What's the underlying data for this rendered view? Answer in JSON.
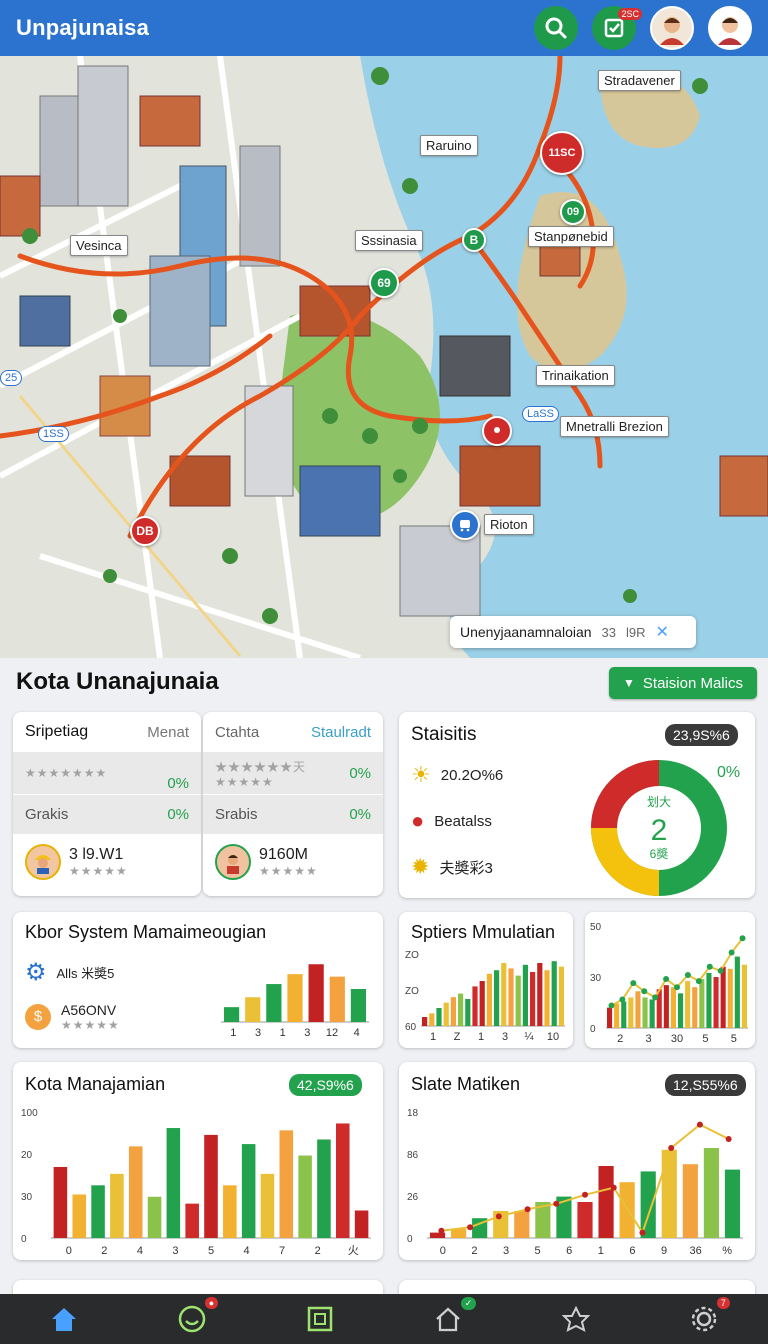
{
  "app": {
    "title": "Unpajunaisa"
  },
  "topbar": {
    "notif_badge": "2SC"
  },
  "map": {
    "labels": {
      "stradavener": "Stradavener",
      "raruino": "Raruino",
      "vesinca": "Vesinca",
      "sssinasia": "Sssinasia",
      "stanponebid": "Stanpønebid",
      "trinaikation": "Trinaikation",
      "mnetralli": "Mnetralli Brezion",
      "rioton": "Rioton"
    },
    "pins": {
      "p1": "11SC",
      "p2": "09",
      "p3": "69",
      "p4": "B",
      "p5": "DB",
      "p6": "1SS",
      "p7": "25",
      "p8": "LaSS"
    },
    "bubble": {
      "text": "Unenyjaanamnaloian",
      "num": "33",
      "unit": "l9R"
    }
  },
  "section": {
    "title": "Kota Unanajunaia",
    "action": "Staision Malics"
  },
  "card1": {
    "title": "Sripetiag",
    "tag": "Menat",
    "row1_stars": "★★★★★★★",
    "row1_val": "0%",
    "row2_label": "Grakis",
    "row2_val": "0%",
    "user_value": "3 l9.W1",
    "user_stars": "★★★★★"
  },
  "card2": {
    "title": "Ctahta",
    "tag": "Staulradt",
    "row1_stars": "★★★★★★天",
    "row1_stars2": "★★★★★",
    "row1_val": "0%",
    "row2_label": "Srabis",
    "row2_val": "0%",
    "user_value": "9160M",
    "user_stars": "★★★★★"
  },
  "card3": {
    "title": "Staisitis",
    "pill": "23,9S%6",
    "items": [
      "20.2O%6",
      "Beatalss",
      "夫奬彩3"
    ],
    "donut_label_top": "划大",
    "donut_value": "2",
    "donut_label_bottom": "6奬",
    "donut_pct": "0%"
  },
  "card4": {
    "title": "Kbor System Mamaimeougian",
    "item1": "Alls 米奬5",
    "item2": "A56ONV",
    "item2_stars": "★★★★★"
  },
  "card5": {
    "title": "Sptiers Mmulatian"
  },
  "card6": {
    "title": ""
  },
  "card7": {
    "title": "Kota Manajamian",
    "pill": "42,S9%6"
  },
  "card8": {
    "title": "Slate Matiken",
    "pill": "12,S55%6"
  },
  "chart_data": [
    {
      "type": "bar",
      "categories": [
        "1",
        "3",
        "1",
        "3",
        "12",
        "4"
      ],
      "values": [
        18,
        30,
        46,
        58,
        70,
        55,
        40
      ],
      "colors": [
        "#23a24d",
        "#e9c036",
        "#23a24d",
        "#f3b132",
        "#c22222",
        "#f3a23f",
        "#23a24d"
      ],
      "ylim": [
        0,
        80
      ]
    },
    {
      "type": "bar",
      "categories": [
        "1",
        "Z",
        "1",
        "3",
        "¼",
        "10"
      ],
      "yticks": [
        "ZO",
        "ZO",
        "60"
      ],
      "values": [
        10,
        14,
        20,
        26,
        32,
        36,
        30,
        44,
        50,
        58,
        62,
        70,
        64,
        56,
        68,
        60,
        70,
        62,
        72,
        66
      ],
      "ylim": [
        0,
        80
      ]
    },
    {
      "type": "bar",
      "categories": [
        "2",
        "3",
        "30",
        "5",
        "5"
      ],
      "yticks": [
        "50",
        "30",
        "0"
      ],
      "values": [
        20,
        24,
        26,
        30,
        36,
        30,
        28,
        38,
        42,
        40,
        34,
        46,
        40,
        48,
        54,
        50,
        60,
        58,
        70,
        62
      ],
      "line": [
        22,
        28,
        44,
        36,
        30,
        48,
        40,
        52,
        46,
        60,
        56,
        74,
        88
      ],
      "ylim": [
        0,
        100
      ]
    },
    {
      "type": "bar",
      "categories": [
        "0",
        "2",
        "4",
        "3",
        "5",
        "4",
        "7",
        "2",
        "火"
      ],
      "yticks": [
        "100",
        "20",
        "30",
        "0"
      ],
      "values": [
        62,
        38,
        46,
        56,
        80,
        36,
        96,
        30,
        90,
        46,
        82,
        56,
        94,
        72,
        86,
        100,
        24
      ],
      "ylim": [
        0,
        110
      ]
    },
    {
      "type": "bar",
      "categories": [
        "0",
        "2",
        "3",
        "5",
        "6",
        "1",
        "6",
        "9",
        "36",
        "%"
      ],
      "yticks": [
        "18",
        "86",
        "26",
        "0"
      ],
      "values": [
        6,
        10,
        22,
        30,
        30,
        40,
        46,
        40,
        80,
        62,
        74,
        98,
        82,
        100,
        76
      ],
      "line": [
        8,
        12,
        24,
        32,
        38,
        48,
        56,
        6,
        100,
        126,
        110
      ],
      "ylim": [
        0,
        140
      ]
    }
  ]
}
